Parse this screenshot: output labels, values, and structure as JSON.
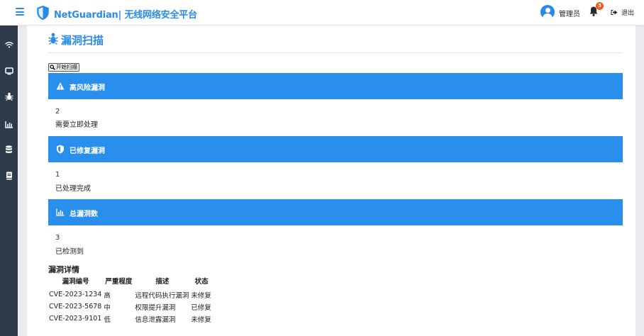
{
  "header": {
    "brand": "NetGuardian| 无线网络安全平台",
    "user_name": "管理员",
    "notification_count": "3",
    "logout": "退出"
  },
  "sidebar": {
    "items": [
      {
        "icon": "wifi-icon"
      },
      {
        "icon": "monitor-icon"
      },
      {
        "icon": "bug-icon"
      },
      {
        "icon": "chart-icon"
      },
      {
        "icon": "database-icon"
      },
      {
        "icon": "book-icon"
      }
    ]
  },
  "page": {
    "title": "漏洞扫描",
    "scan_button": "开始扫描"
  },
  "cards": [
    {
      "icon": "warning-icon",
      "label": "高风险漏洞",
      "value": "2",
      "desc": "需要立即处理"
    },
    {
      "icon": "shield-icon",
      "label": "已修复漏洞",
      "value": "1",
      "desc": "已处理完成"
    },
    {
      "icon": "chart-icon",
      "label": "总漏洞数",
      "value": "3",
      "desc": "已检测到"
    }
  ],
  "details": {
    "title": "漏洞详情",
    "columns": [
      "漏洞编号",
      "严重程度",
      "描述",
      "状态"
    ],
    "rows": [
      [
        "CVE-2023-1234",
        "高",
        "远程代码执行漏洞",
        "未修复"
      ],
      [
        "CVE-2023-5678",
        "中",
        "权限提升漏洞",
        "已修复"
      ],
      [
        "CVE-2023-9101",
        "低",
        "信息泄露漏洞",
        "未修复"
      ]
    ]
  },
  "colors": {
    "accent": "#2a8eec",
    "sidebar": "#2e3b4b",
    "badge": "#f25a1d"
  }
}
